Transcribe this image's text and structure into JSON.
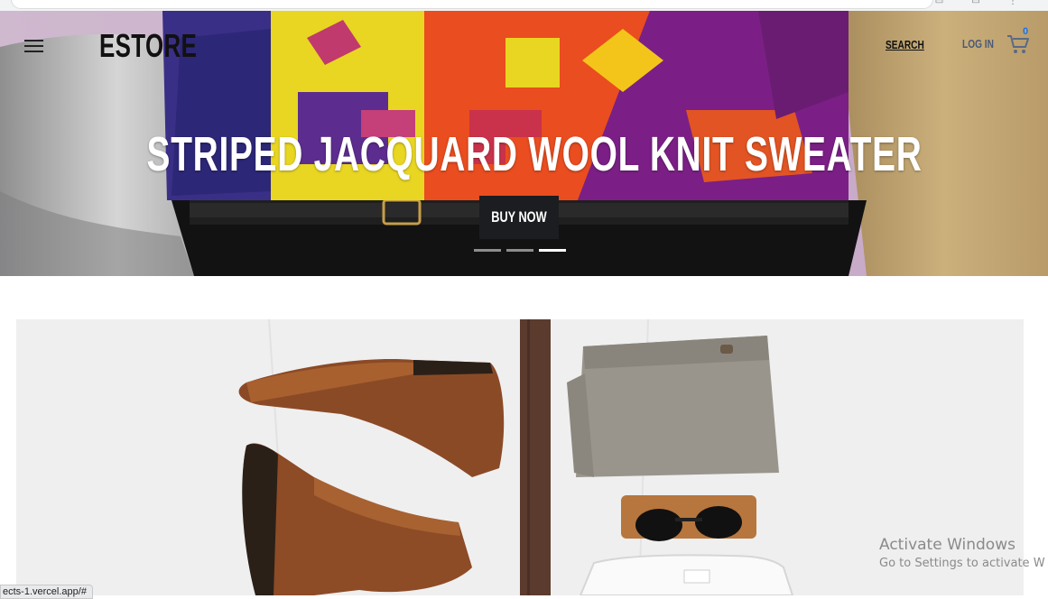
{
  "navbar": {
    "brand": "ESTORE",
    "search_label": "SEARCH",
    "login_label": "LOG IN",
    "cart_count": "0"
  },
  "hero": {
    "headline": "STRIPED JACQUARD WOOL KNIT SWEATER",
    "button_label": "BUY NOW",
    "slides_total": 3,
    "active_slide": 3
  },
  "os_watermark": {
    "title": "Activate Windows",
    "subtitle": "Go to Settings to activate W"
  },
  "status_bar": {
    "url": "ects-1.vercel.app/#"
  },
  "icons": {
    "menu": "hamburger-icon",
    "cart": "shopping-cart-icon"
  },
  "colors": {
    "dark": "#1b1d20",
    "link_blue": "#4a5a76",
    "badge_blue": "#1a73e8"
  }
}
